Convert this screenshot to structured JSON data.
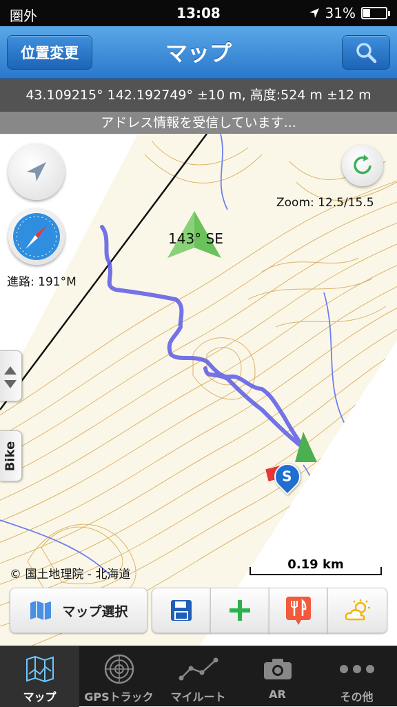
{
  "status_bar": {
    "carrier": "圏外",
    "time": "13:08",
    "battery": "31%",
    "battery_level": 0.31
  },
  "nav": {
    "title": "マップ",
    "left_button": "位置変更",
    "search_icon": "search-icon"
  },
  "info": {
    "coords": "43.109215° 142.192749° ±10 m, 高度:524 m ±12 m",
    "address": "アドレス情報を受信しています..."
  },
  "map": {
    "heading": "143° SE",
    "zoom": "Zoom: 12.5/15.5",
    "course": "進路: 191°M",
    "copyright": "© 国土地理院 - 北海道",
    "scale": "0.19 km",
    "side_tab": "Bike",
    "gps_marker": "S",
    "colors": {
      "track": "#5a5ae6",
      "contour": "#d4a955",
      "river": "#6f7ff0",
      "heading_arrow": "#6bc25a"
    }
  },
  "toolbar": {
    "map_select": "マップ選択",
    "icons": [
      "map-icon",
      "save-icon",
      "add-icon",
      "restaurant-icon",
      "weather-icon"
    ]
  },
  "tabs": [
    {
      "label": "マップ",
      "icon": "map-icon"
    },
    {
      "label": "GPSトラック",
      "icon": "radar-icon"
    },
    {
      "label": "マイルート",
      "icon": "route-icon"
    },
    {
      "label": "AR",
      "icon": "camera-icon"
    },
    {
      "label": "その他",
      "icon": "more-icon"
    }
  ],
  "active_tab": 0
}
